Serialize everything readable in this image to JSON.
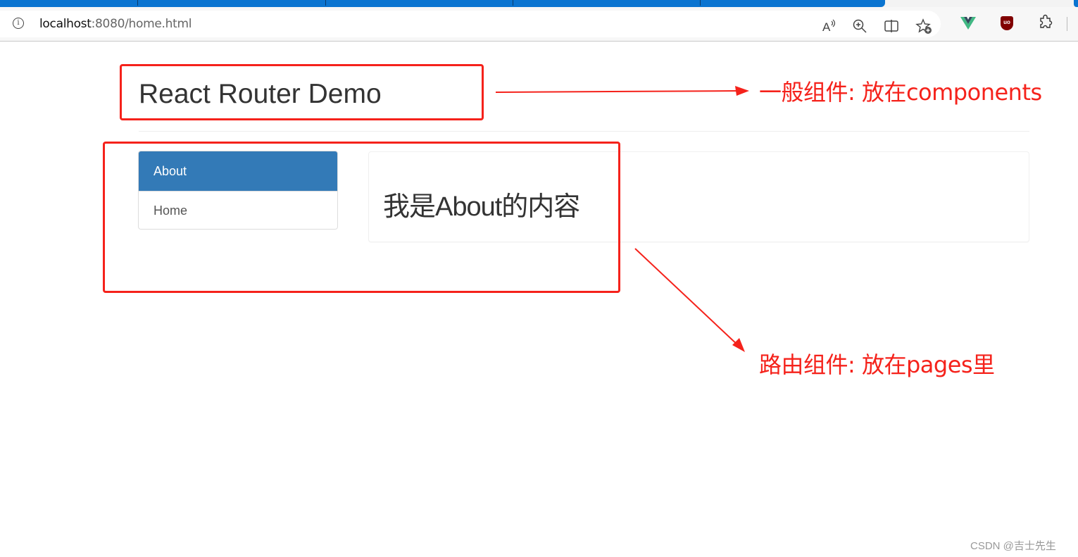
{
  "browser": {
    "url_host": "localhost",
    "url_rest": ":8080/home.html",
    "toolbar_icons": [
      "read-aloud-icon",
      "zoom-icon",
      "split-screen-icon",
      "add-favorite-icon",
      "vue-devtools-icon",
      "ublock-icon",
      "extensions-icon"
    ],
    "ublock_label": "uo"
  },
  "page": {
    "header_title": "React Router Demo",
    "nav": [
      {
        "label": "About",
        "active": true
      },
      {
        "label": "Home",
        "active": false
      }
    ],
    "content_text": "我是About的内容"
  },
  "annotations": {
    "general_component": "一般组件: 放在components",
    "route_component": "路由组件: 放在pages里",
    "color": "#f5221b"
  },
  "watermark": "CSDN @吉士先生",
  "colors": {
    "active_nav": "#337ab7",
    "browser_accent": "#0a74d0"
  }
}
